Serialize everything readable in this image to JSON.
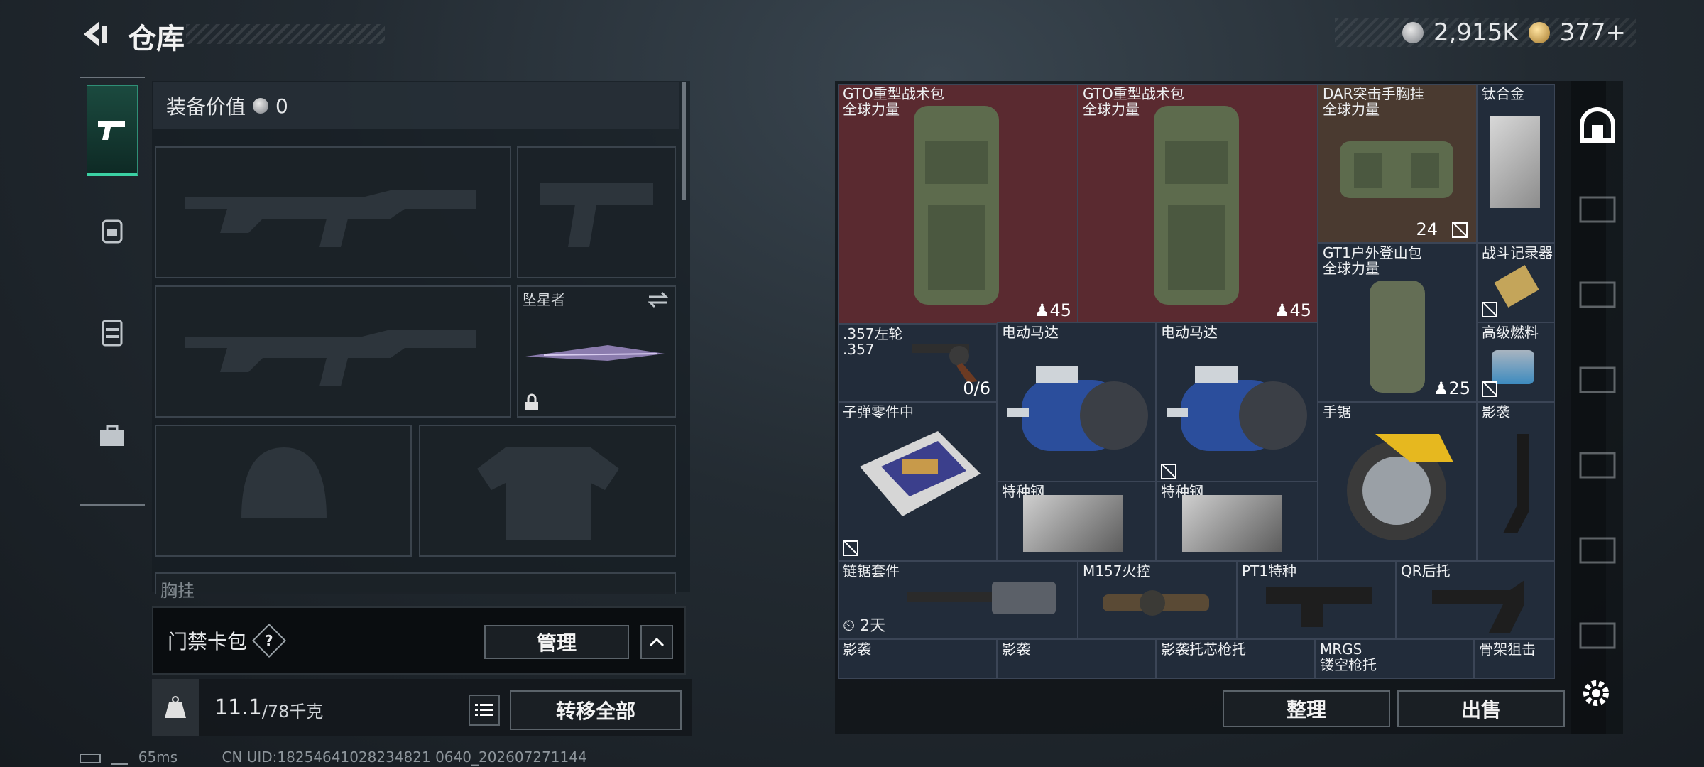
{
  "header": {
    "title": "仓库",
    "currency1": "2,915K",
    "currency2": "377+"
  },
  "equipment": {
    "value_label": "装备价值",
    "value": "0",
    "melee_name": "坠星者",
    "chest_label": "胸挂",
    "chest_extra": "?"
  },
  "keycard": {
    "label": "门禁卡包",
    "help": "?",
    "manage": "管理"
  },
  "weight": {
    "current": "11.1",
    "max_unit": "/78千克",
    "transfer_all": "转移全部"
  },
  "status": {
    "ping": "65ms",
    "uid": "CN UID:18254641028234821 0640_202607271144"
  },
  "inventory": {
    "items": [
      {
        "name": "GTO重型战术包\n全球力量",
        "count": "45"
      },
      {
        "name": "GTO重型战术包\n全球力量",
        "count": "45"
      },
      {
        "name": "DAR突击手胸挂\n全球力量",
        "count": "24"
      },
      {
        "name": "钛合金"
      },
      {
        "name": "GT1户外登山包\n全球力量",
        "count": "25"
      },
      {
        "name": "战斗记录器"
      },
      {
        "name": ".357左轮\n.357",
        "count": "0/6"
      },
      {
        "name": "电动马达"
      },
      {
        "name": "电动马达"
      },
      {
        "name": "高级燃料"
      },
      {
        "name": "子弹零件中"
      },
      {
        "name": "手锯"
      },
      {
        "name": "影袭"
      },
      {
        "name": "特种钢"
      },
      {
        "name": "特种钢"
      },
      {
        "name": "链锯套件",
        "timer": "2天"
      },
      {
        "name": "M157火控"
      },
      {
        "name": "PT1特种"
      },
      {
        "name": "QR后托"
      },
      {
        "name": "影袭"
      },
      {
        "name": "影袭"
      },
      {
        "name": "影袭托芯枪托"
      },
      {
        "name": "MRGS\n镂空枪托"
      },
      {
        "name": "骨架狙击"
      }
    ]
  },
  "actions": {
    "sort": "整理",
    "sell": "出售"
  },
  "icons": [
    "back-arrow-icon",
    "pistol-icon",
    "backpack-icon",
    "vest-icon",
    "toolbox-icon",
    "home-icon",
    "settings-gear-icon",
    "weight-kg-icon",
    "list-icon",
    "lock-icon",
    "swap-icon"
  ]
}
